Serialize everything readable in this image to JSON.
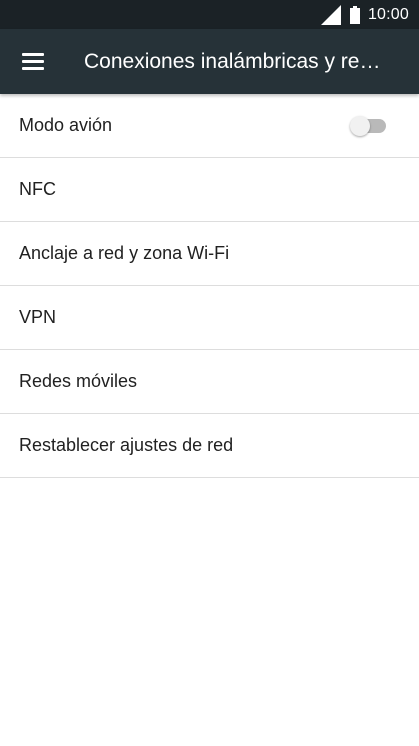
{
  "status_bar": {
    "time": "10:00",
    "icons": [
      "signal-icon",
      "battery-icon"
    ]
  },
  "app_bar": {
    "title": "Conexiones inalámbricas y re…",
    "nav_icon": "menu-icon"
  },
  "settings": {
    "items": [
      {
        "label": "Modo avión",
        "toggle": true,
        "toggle_on": false
      },
      {
        "label": "NFC"
      },
      {
        "label": "Anclaje a red y zona Wi-Fi"
      },
      {
        "label": "VPN"
      },
      {
        "label": "Redes móviles"
      },
      {
        "label": "Restablecer ajustes de red"
      }
    ]
  },
  "colors": {
    "status_bar": "#1b2226",
    "app_bar": "#263238",
    "text": "#212121",
    "divider": "#dddddd"
  }
}
